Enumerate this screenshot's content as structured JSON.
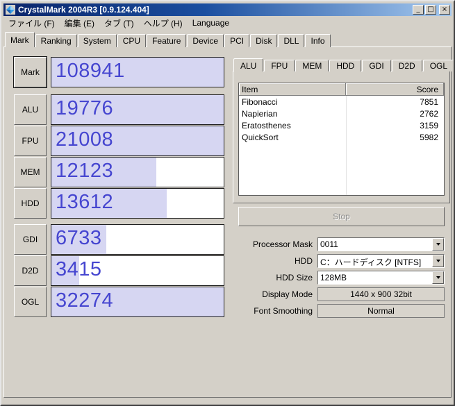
{
  "window": {
    "title": "CrystalMark 2004R3 [0.9.124.404]",
    "minimize_label": "_",
    "maximize_label": "□",
    "close_label": "×"
  },
  "menu": {
    "items": [
      "ファイル (F)",
      "編集 (E)",
      "タブ (T)",
      "ヘルプ (H)",
      "Language"
    ]
  },
  "main_tabs": {
    "active": "Mark",
    "items": [
      "Mark",
      "Ranking",
      "System",
      "CPU",
      "Feature",
      "Device",
      "PCI",
      "Disk",
      "DLL",
      "Info"
    ]
  },
  "scores": [
    {
      "label": "Mark",
      "value": "108941",
      "fill": "100%"
    },
    {
      "label": "ALU",
      "value": "19776",
      "fill": "100%"
    },
    {
      "label": "FPU",
      "value": "21008",
      "fill": "100%"
    },
    {
      "label": "MEM",
      "value": "12123",
      "fill": "61%"
    },
    {
      "label": "HDD",
      "value": "13612",
      "fill": "67%"
    },
    {
      "label": "GDI",
      "value": "6733",
      "fill": "32%"
    },
    {
      "label": "D2D",
      "value": "3415",
      "fill": "16%"
    },
    {
      "label": "OGL",
      "value": "32274",
      "fill": "100%"
    }
  ],
  "detail_tabs": {
    "active": "ALU",
    "items": [
      "ALU",
      "FPU",
      "MEM",
      "HDD",
      "GDI",
      "D2D",
      "OGL"
    ]
  },
  "result_table": {
    "columns": [
      "Item",
      "Score"
    ],
    "rows": [
      {
        "item": "Fibonacci",
        "score": "7851"
      },
      {
        "item": "Napierian",
        "score": "2762"
      },
      {
        "item": "Eratosthenes",
        "score": "3159"
      },
      {
        "item": "QuickSort",
        "score": "5982"
      }
    ]
  },
  "stop_button": {
    "label": "Stop",
    "state": "disabled"
  },
  "settings": {
    "processor_mask": {
      "label": "Processor Mask",
      "value": "0011"
    },
    "hdd": {
      "label": "HDD",
      "value": "C：ハードディスク [NTFS]"
    },
    "hdd_size": {
      "label": "HDD Size",
      "value": "128MB"
    },
    "display_mode": {
      "label": "Display Mode",
      "value": "1440 x 900 32bit"
    },
    "font_smoothing": {
      "label": "Font Smoothing",
      "value": "Normal"
    }
  },
  "colors": {
    "window_bg": "#d4d0c8",
    "titlebar_left": "#0a246a",
    "titlebar_right": "#a6caf0",
    "score_text": "#4646d0",
    "score_fill": "#d6d6f2",
    "disabled_text": "#8c8c8c"
  }
}
